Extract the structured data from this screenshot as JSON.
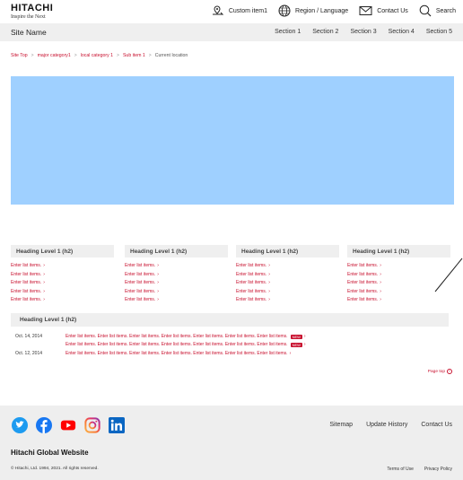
{
  "header": {
    "brand": "HITACHI",
    "tagline": "Inspire the Next",
    "utilities": [
      {
        "label": "Custom item1",
        "icon": "pin-key-icon"
      },
      {
        "label": "Region / Language",
        "icon": "globe-icon"
      },
      {
        "label": "Contact Us",
        "icon": "mail-icon"
      },
      {
        "label": "Search",
        "icon": "search-icon"
      }
    ]
  },
  "nav": {
    "site_name": "Site Name",
    "sections": [
      "Section 1",
      "Section 2",
      "Section 3",
      "Section 4",
      "Section 5"
    ]
  },
  "breadcrumb": {
    "items": [
      "Site Top",
      "major category1",
      "local category 1",
      "Sub item 1"
    ],
    "current": "Current location"
  },
  "hero": {
    "color": "#9fd0ff"
  },
  "columns": [
    {
      "heading": "Heading Level 1 (h2)",
      "items": [
        "Enter list items.",
        "Enter list items.",
        "Enter list items.",
        "Enter list items.",
        "Enter list items."
      ]
    },
    {
      "heading": "Heading Level 1 (h2)",
      "items": [
        "Enter list items.",
        "Enter list items.",
        "Enter list items.",
        "Enter list items.",
        "Enter list items."
      ]
    },
    {
      "heading": "Heading Level 1 (h2)",
      "items": [
        "Enter list items.",
        "Enter list items.",
        "Enter list items.",
        "Enter list items.",
        "Enter list items."
      ]
    },
    {
      "heading": "Heading Level 1 (h2)",
      "items": [
        "Enter list items.",
        "Enter list items.",
        "Enter list items.",
        "Enter list items.",
        "Enter list items."
      ]
    }
  ],
  "news": {
    "heading": "Heading Level 1 (h2)",
    "rows": [
      {
        "date": "Oct. 14, 2014",
        "text": "Enter list items. Enter list items. Enter list items. Enter list items. Enter list items. Enter list items. Enter list items.",
        "badge": "NEW"
      },
      {
        "date": "",
        "text": "Enter list items. Enter list items. Enter list items. Enter list items. Enter list items. Enter list items. Enter list items.",
        "badge": "NEW"
      },
      {
        "date": "Oct. 12, 2014",
        "text": "Enter list items. Enter list items. Enter list items. Enter list items. Enter list items. Enter list items. Enter list items.",
        "badge": ""
      }
    ]
  },
  "page_top": "Page top",
  "footer": {
    "social": [
      "twitter-icon",
      "facebook-icon",
      "youtube-icon",
      "instagram-icon",
      "linkedin-icon"
    ],
    "links": [
      "Sitemap",
      "Update History",
      "Contact Us"
    ],
    "global_site": "Hitachi Global Website",
    "copyright": "© Hitachi, Ltd. 1994, 2021. All rights reserved.",
    "legal": [
      "Terms of Use",
      "Privacy Policy"
    ]
  },
  "colors": {
    "accent": "#c8102e",
    "hero": "#9fd0ff",
    "panel": "#efefef"
  }
}
